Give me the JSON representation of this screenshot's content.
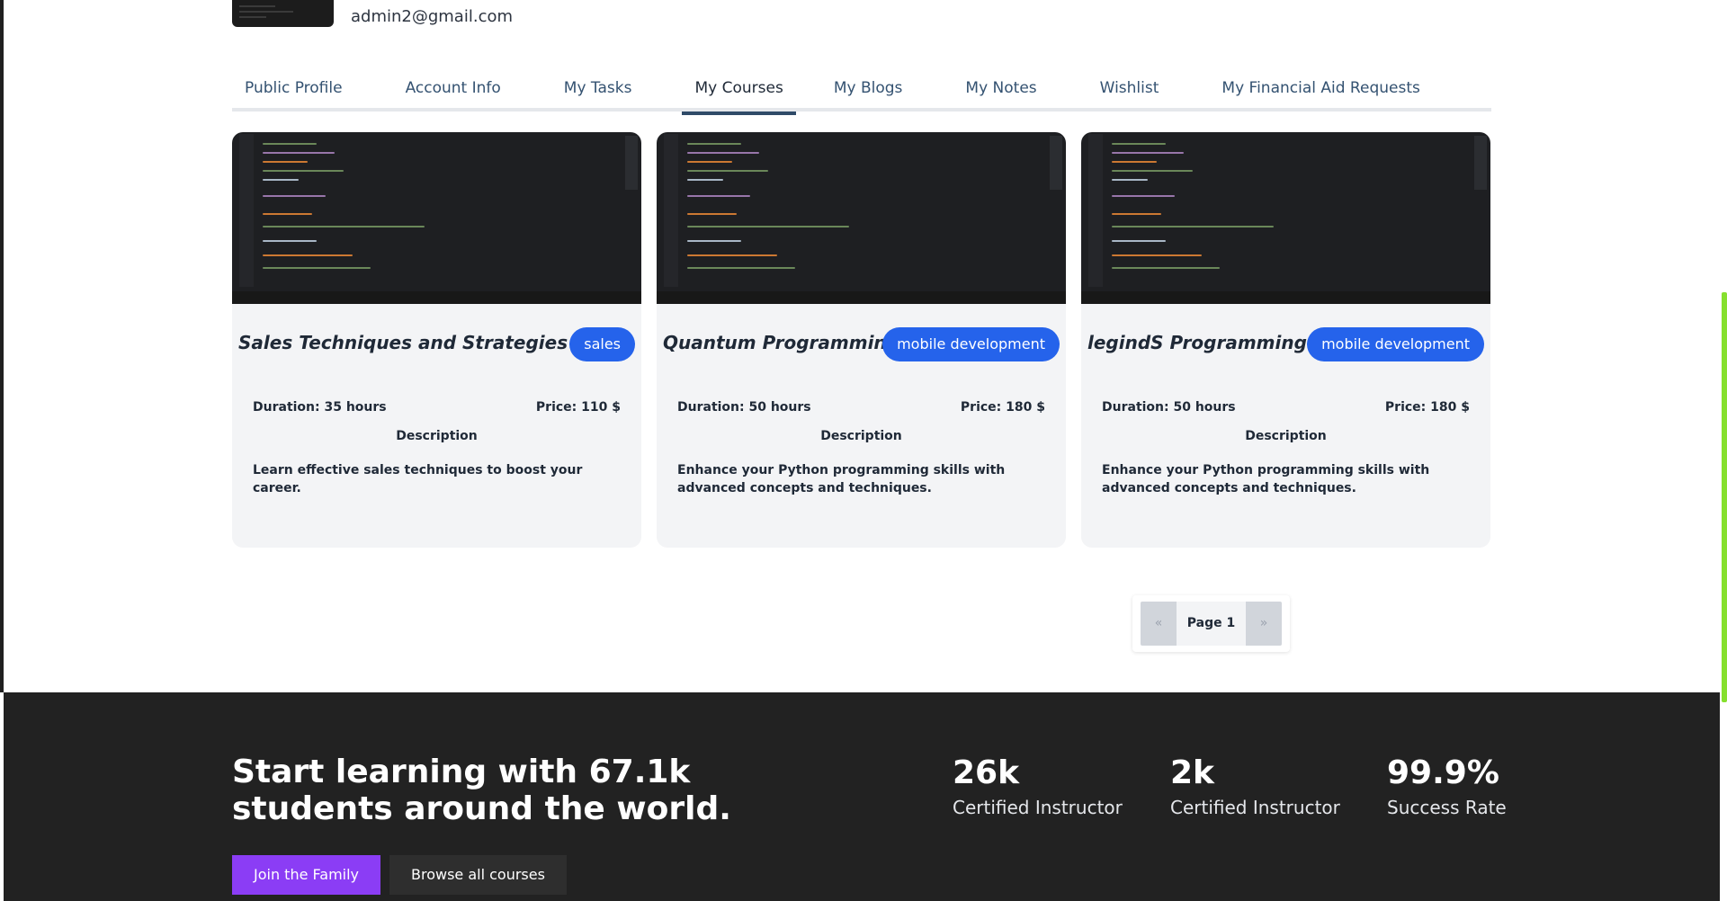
{
  "profile": {
    "email": "admin2@gmail.com"
  },
  "tabs": [
    {
      "label": "Public Profile",
      "active": false
    },
    {
      "label": "Account Info",
      "active": false
    },
    {
      "label": "My Tasks",
      "active": false
    },
    {
      "label": "My Courses",
      "active": true
    },
    {
      "label": "My Blogs",
      "active": false
    },
    {
      "label": "My Notes",
      "active": false
    },
    {
      "label": "Wishlist",
      "active": false
    },
    {
      "label": "My Financial Aid Requests",
      "active": false
    }
  ],
  "courses": [
    {
      "title": "Sales Techniques and Strategies",
      "category": "sales",
      "duration": "Duration: 35 hours",
      "price": "Price: 110 $",
      "description_heading": "Description",
      "description": "Learn effective sales techniques to boost your career."
    },
    {
      "title": "Quantum Programming",
      "category": "mobile development",
      "duration": "Duration: 50 hours",
      "price": "Price: 180 $",
      "description_heading": "Description",
      "description": "Enhance your Python programming skills with advanced concepts and techniques."
    },
    {
      "title": "legindS Programming",
      "category": "mobile development",
      "duration": "Duration: 50 hours",
      "price": "Price: 180 $",
      "description_heading": "Description",
      "description": "Enhance your Python programming skills with advanced concepts and techniques."
    }
  ],
  "pagination": {
    "prev": "«",
    "current": "Page 1",
    "next": "»"
  },
  "footer": {
    "headline": "Start learning with 67.1k students around the world.",
    "stats": [
      {
        "value": "26k",
        "label": "Certified Instructor"
      },
      {
        "value": "2k",
        "label": "Certified Instructor"
      },
      {
        "value": "99.9%",
        "label": "Success Rate"
      }
    ],
    "join_label": "Join the Family",
    "browse_label": "Browse all courses"
  },
  "colors": {
    "accent_blue": "#2563eb",
    "purple": "#8b3df5",
    "footer_bg": "#222222",
    "card_bg": "#f3f4f6"
  }
}
